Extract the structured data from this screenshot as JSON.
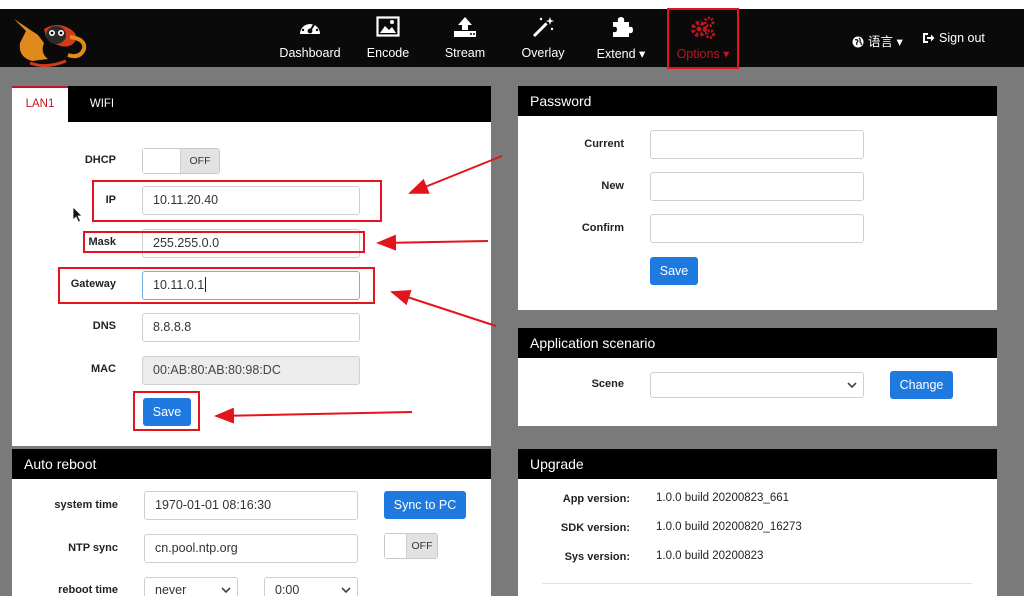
{
  "nav": {
    "items": [
      {
        "label": "Dashboard",
        "icon": "dashboard-icon"
      },
      {
        "label": "Encode",
        "icon": "image-icon"
      },
      {
        "label": "Stream",
        "icon": "upload-icon"
      },
      {
        "label": "Overlay",
        "icon": "magic-wand-icon"
      },
      {
        "label": "Extend ▾",
        "icon": "puzzle-icon"
      },
      {
        "label": "Options ▾",
        "icon": "gears-icon",
        "active": true
      }
    ],
    "language": "语言 ▾",
    "sign_out": "Sign out"
  },
  "network": {
    "tabs": [
      "LAN1",
      "WIFI"
    ],
    "dhcp_label": "DHCP",
    "dhcp_state": "OFF",
    "ip_label": "IP",
    "ip_value": "10.11.20.40",
    "mask_label": "Mask",
    "mask_value": "255.255.0.0",
    "gateway_label": "Gateway",
    "gateway_value": "10.11.0.1",
    "dns_label": "DNS",
    "dns_value": "8.8.8.8",
    "mac_label": "MAC",
    "mac_value": "00:AB:80:AB:80:98:DC",
    "save_label": "Save"
  },
  "password": {
    "title": "Password",
    "current_label": "Current",
    "new_label": "New",
    "confirm_label": "Confirm",
    "save_label": "Save"
  },
  "scenario": {
    "title": "Application scenario",
    "scene_label": "Scene",
    "scene_value": "",
    "change_label": "Change"
  },
  "reboot": {
    "title": "Auto reboot",
    "system_time_label": "system time",
    "system_time_value": "1970-01-01 08:16:30",
    "sync_label": "Sync to PC",
    "ntp_label": "NTP sync",
    "ntp_value": "cn.pool.ntp.org",
    "ntp_state": "OFF",
    "reboot_time_label": "reboot time",
    "reboot_freq": "never",
    "reboot_clock": "0:00"
  },
  "upgrade": {
    "title": "Upgrade",
    "app_label": "App version:",
    "app_value": "1.0.0 build 20200823_661",
    "sdk_label": "SDK version:",
    "sdk_value": "1.0.0 build 20200820_16273",
    "sys_label": "Sys version:",
    "sys_value": "1.0.0 build 20200823"
  },
  "colors": {
    "accent_blue": "#1f7ae0",
    "active_red": "#c0141e",
    "annotation_red": "#e3151c",
    "header_black": "#000000"
  }
}
